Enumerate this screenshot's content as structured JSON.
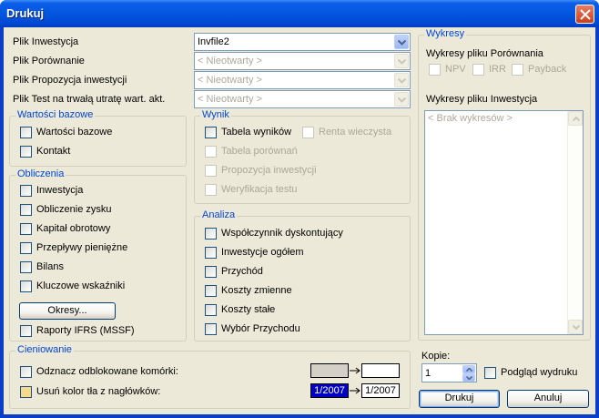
{
  "window": {
    "title": "Drukuj"
  },
  "files": {
    "rows": [
      {
        "label": "Plik Inwestycja",
        "value": "Invfile2",
        "enabled": true
      },
      {
        "label": "Plik Porównanie",
        "value": "< Nieotwarty >",
        "enabled": false
      },
      {
        "label": "Plik Propozycja inwestycji",
        "value": "< Nieotwarty >",
        "enabled": false
      },
      {
        "label": "Plik Test na trwałą utratę wart. akt.",
        "value": "< Nieotwarty >",
        "enabled": false
      }
    ]
  },
  "wartosci": {
    "title": "Wartości bazowe",
    "items": [
      {
        "label": "Wartości bazowe",
        "checked": false,
        "enabled": true
      },
      {
        "label": "Kontakt",
        "checked": false,
        "enabled": true
      }
    ]
  },
  "obliczenia": {
    "title": "Obliczenia",
    "items": [
      {
        "label": "Inwestycja",
        "checked": false,
        "enabled": true
      },
      {
        "label": "Obliczenie zysku",
        "checked": false,
        "enabled": true
      },
      {
        "label": "Kapitał obrotowy",
        "checked": false,
        "enabled": true
      },
      {
        "label": "Przepływy pieniężne",
        "checked": false,
        "enabled": true
      },
      {
        "label": "Bilans",
        "checked": false,
        "enabled": true
      },
      {
        "label": "Kluczowe wskaźniki",
        "checked": false,
        "enabled": true
      }
    ],
    "okresy_button": "Okresy...",
    "raporty": {
      "label": "Raporty IFRS (MSSF)",
      "checked": false
    }
  },
  "wynik": {
    "title": "Wynik",
    "items": [
      {
        "label": "Tabela wyników",
        "checked": false,
        "enabled": true
      },
      {
        "label": "Renta wieczysta",
        "checked": false,
        "enabled": false
      },
      {
        "label": "Tabela porównań",
        "checked": false,
        "enabled": false
      },
      {
        "label": "Propozycja inwestycji",
        "checked": false,
        "enabled": false
      },
      {
        "label": "Weryfikacja testu",
        "checked": false,
        "enabled": false
      }
    ]
  },
  "analiza": {
    "title": "Analiza",
    "items": [
      {
        "label": "Współczynnik dyskontujący",
        "checked": false,
        "enabled": true
      },
      {
        "label": "Inwestycje ogółem",
        "checked": false,
        "enabled": true
      },
      {
        "label": "Przychód",
        "checked": false,
        "enabled": true
      },
      {
        "label": "Koszty zmienne",
        "checked": false,
        "enabled": true
      },
      {
        "label": "Koszty stałe",
        "checked": false,
        "enabled": true
      },
      {
        "label": "Wybór Przychodu",
        "checked": false,
        "enabled": true
      }
    ]
  },
  "wykresy": {
    "title": "Wykresy",
    "porownania_label": "Wykresy pliku Porównania",
    "porownania_items": [
      {
        "label": "NPV",
        "checked": false,
        "enabled": false
      },
      {
        "label": "IRR",
        "checked": false,
        "enabled": false
      },
      {
        "label": "Payback",
        "checked": false,
        "enabled": false
      }
    ],
    "inwestycja_label": "Wykresy pliku Inwestycja",
    "list_placeholder": "< Brak wykresów >"
  },
  "cieniowanie": {
    "title": "Cieniowanie",
    "items": [
      {
        "label": "Odznacz odblokowane komórki:",
        "checked": false,
        "style": "normal"
      },
      {
        "label": "Usuń kolor tła z nagłówków:",
        "checked": false,
        "style": "yellow"
      }
    ],
    "header_sample_from": "1/2007",
    "header_sample_to": "1/2007",
    "colors": {
      "unlocked_from": "#d4d0c8",
      "unlocked_to": "#ffffff",
      "header_from": "#0000c0",
      "header_to": "#ffffff"
    }
  },
  "kopie": {
    "label": "Kopie:",
    "value": "1"
  },
  "podglad": {
    "label": "Podgląd wydruku",
    "checked": false
  },
  "buttons": {
    "print": "Drukuj",
    "cancel": "Anuluj"
  }
}
